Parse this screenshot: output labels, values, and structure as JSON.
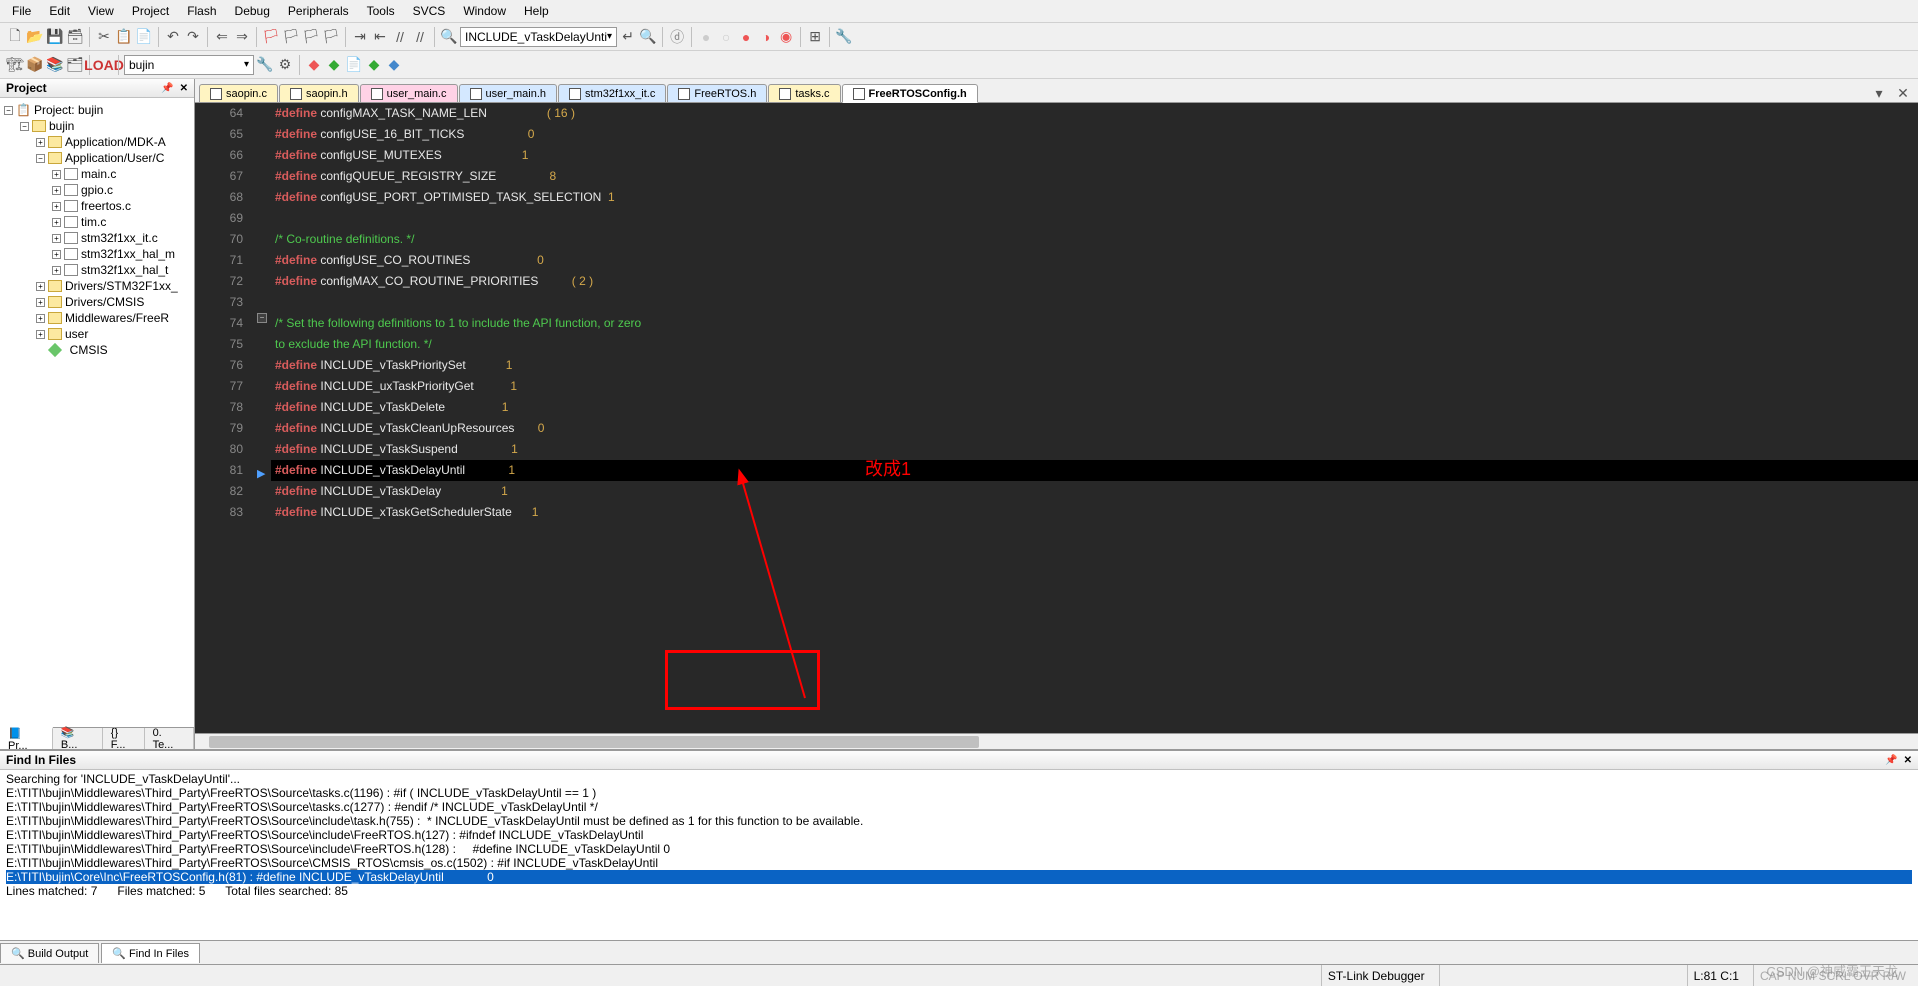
{
  "menu": [
    "File",
    "Edit",
    "View",
    "Project",
    "Flash",
    "Debug",
    "Peripherals",
    "Tools",
    "SVCS",
    "Window",
    "Help"
  ],
  "toolbar2_dropdown": "INCLUDE_vTaskDelayUnti",
  "target_dropdown": "bujin",
  "project_panel": {
    "title": "Project",
    "root": "Project: bujin",
    "target": "bujin",
    "groups": [
      {
        "name": "Application/MDK-A",
        "expanded": false,
        "children": []
      },
      {
        "name": "Application/User/C",
        "expanded": true,
        "children": [
          "main.c",
          "gpio.c",
          "freertos.c",
          "tim.c",
          "stm32f1xx_it.c",
          "stm32f1xx_hal_m",
          "stm32f1xx_hal_t"
        ]
      },
      {
        "name": "Drivers/STM32F1xx_",
        "expanded": false,
        "children": []
      },
      {
        "name": "Drivers/CMSIS",
        "expanded": false,
        "children": []
      },
      {
        "name": "Middlewares/FreeR",
        "expanded": false,
        "children": []
      },
      {
        "name": "user",
        "expanded": false,
        "children": []
      }
    ],
    "cmsis": "CMSIS"
  },
  "bottom_tabs": [
    {
      "icon": "📘",
      "label": "Pr...",
      "active": true
    },
    {
      "icon": "📚",
      "label": "B..."
    },
    {
      "icon": "{}",
      "label": "F..."
    },
    {
      "icon": "0.",
      "label": "Te..."
    }
  ],
  "editor_tabs": [
    {
      "label": "saopin.c",
      "cls": "yellow"
    },
    {
      "label": "saopin.h",
      "cls": "yellow"
    },
    {
      "label": "user_main.c",
      "cls": "pink"
    },
    {
      "label": "user_main.h",
      "cls": "blue"
    },
    {
      "label": "stm32f1xx_it.c",
      "cls": "blue"
    },
    {
      "label": "FreeRTOS.h",
      "cls": "blue"
    },
    {
      "label": "tasks.c",
      "cls": "yellow"
    },
    {
      "label": "FreeRTOSConfig.h",
      "cls": "active"
    }
  ],
  "code_lines": [
    {
      "n": 64,
      "t": "<kw>#define</kw> <idn>configMAX_TASK_NAME_LEN</idn>                  <par>(</par> <num>16</num> <par>)</par>"
    },
    {
      "n": 65,
      "t": "<kw>#define</kw> <idn>configUSE_16_BIT_TICKS</idn>                   <num>0</num>"
    },
    {
      "n": 66,
      "t": "<kw>#define</kw> <idn>configUSE_MUTEXES</idn>                        <num>1</num>"
    },
    {
      "n": 67,
      "t": "<kw>#define</kw> <idn>configQUEUE_REGISTRY_SIZE</idn>                <num>8</num>"
    },
    {
      "n": 68,
      "t": "<kw>#define</kw> <idn>configUSE_PORT_OPTIMISED_TASK_SELECTION</idn>  <num>1</num>"
    },
    {
      "n": 69,
      "t": ""
    },
    {
      "n": 70,
      "t": "<cmt>/* Co-routine definitions. */</cmt>"
    },
    {
      "n": 71,
      "t": "<kw>#define</kw> <idn>configUSE_CO_ROUTINES</idn>                    <num>0</num>"
    },
    {
      "n": 72,
      "t": "<kw>#define</kw> <idn>configMAX_CO_ROUTINE_PRIORITIES</idn>          <par>(</par> <num>2</num> <par>)</par>"
    },
    {
      "n": 73,
      "t": ""
    },
    {
      "n": 74,
      "t": "<cmt>/* Set the following definitions to 1 to include the API function, or zero</cmt>",
      "fold": true
    },
    {
      "n": 75,
      "t": "<cmt>to exclude the API function. */</cmt>"
    },
    {
      "n": 76,
      "t": "<kw>#define</kw> <idn>INCLUDE_vTaskPrioritySet</idn>            <num>1</num>"
    },
    {
      "n": 77,
      "t": "<kw>#define</kw> <idn>INCLUDE_uxTaskPriorityGet</idn>           <num>1</num>"
    },
    {
      "n": 78,
      "t": "<kw>#define</kw> <idn>INCLUDE_vTaskDelete</idn>                 <num>1</num>"
    },
    {
      "n": 79,
      "t": "<kw>#define</kw> <idn>INCLUDE_vTaskCleanUpResources</idn>       <num>0</num>"
    },
    {
      "n": 80,
      "t": "<kw>#define</kw> <idn>INCLUDE_vTaskSuspend</idn>                <num>1</num>"
    },
    {
      "n": 81,
      "t": "<kw>#define</kw> <idn>INCLUDE_vTaskDelayUntil</idn>             <num>1</num>",
      "hl": true,
      "arrow": true
    },
    {
      "n": 82,
      "t": "<kw>#define</kw> <idn>INCLUDE_vTaskDelay</idn>                  <num>1</num>"
    },
    {
      "n": 83,
      "t": "<kw>#define</kw> <idn>INCLUDE_xTaskGetSchedulerState</idn>      <num>1</num>"
    }
  ],
  "find_panel": {
    "title": "Find In Files",
    "lines": [
      "Searching for 'INCLUDE_vTaskDelayUntil'...",
      "E:\\TITI\\bujin\\Middlewares\\Third_Party\\FreeRTOS\\Source\\tasks.c(1196) : #if ( INCLUDE_vTaskDelayUntil == 1 )",
      "E:\\TITI\\bujin\\Middlewares\\Third_Party\\FreeRTOS\\Source\\tasks.c(1277) : #endif /* INCLUDE_vTaskDelayUntil */",
      "E:\\TITI\\bujin\\Middlewares\\Third_Party\\FreeRTOS\\Source\\include\\task.h(755) :  * INCLUDE_vTaskDelayUntil must be defined as 1 for this function to be available.",
      "E:\\TITI\\bujin\\Middlewares\\Third_Party\\FreeRTOS\\Source\\include\\FreeRTOS.h(127) : #ifndef INCLUDE_vTaskDelayUntil",
      "E:\\TITI\\bujin\\Middlewares\\Third_Party\\FreeRTOS\\Source\\include\\FreeRTOS.h(128) :     #define INCLUDE_vTaskDelayUntil 0",
      "E:\\TITI\\bujin\\Middlewares\\Third_Party\\FreeRTOS\\Source\\CMSIS_RTOS\\cmsis_os.c(1502) : #if INCLUDE_vTaskDelayUntil"
    ],
    "selected": "E:\\TITI\\bujin\\Core\\Inc\\FreeRTOSConfig.h(81) : #define INCLUDE_vTaskDelayUntil             0",
    "summary": "Lines matched: 7      Files matched: 5      Total files searched: 85"
  },
  "find_tabs": [
    {
      "label": "Build Output",
      "active": false
    },
    {
      "label": "Find In Files",
      "active": true
    }
  ],
  "status": {
    "debugger": "ST-Link Debugger",
    "pos": "L:81 C:1",
    "caps": "CAP NUM SCRL OVR R/W"
  },
  "annotation": "改成1",
  "watermark": "CSDN @神威霸王天龙"
}
